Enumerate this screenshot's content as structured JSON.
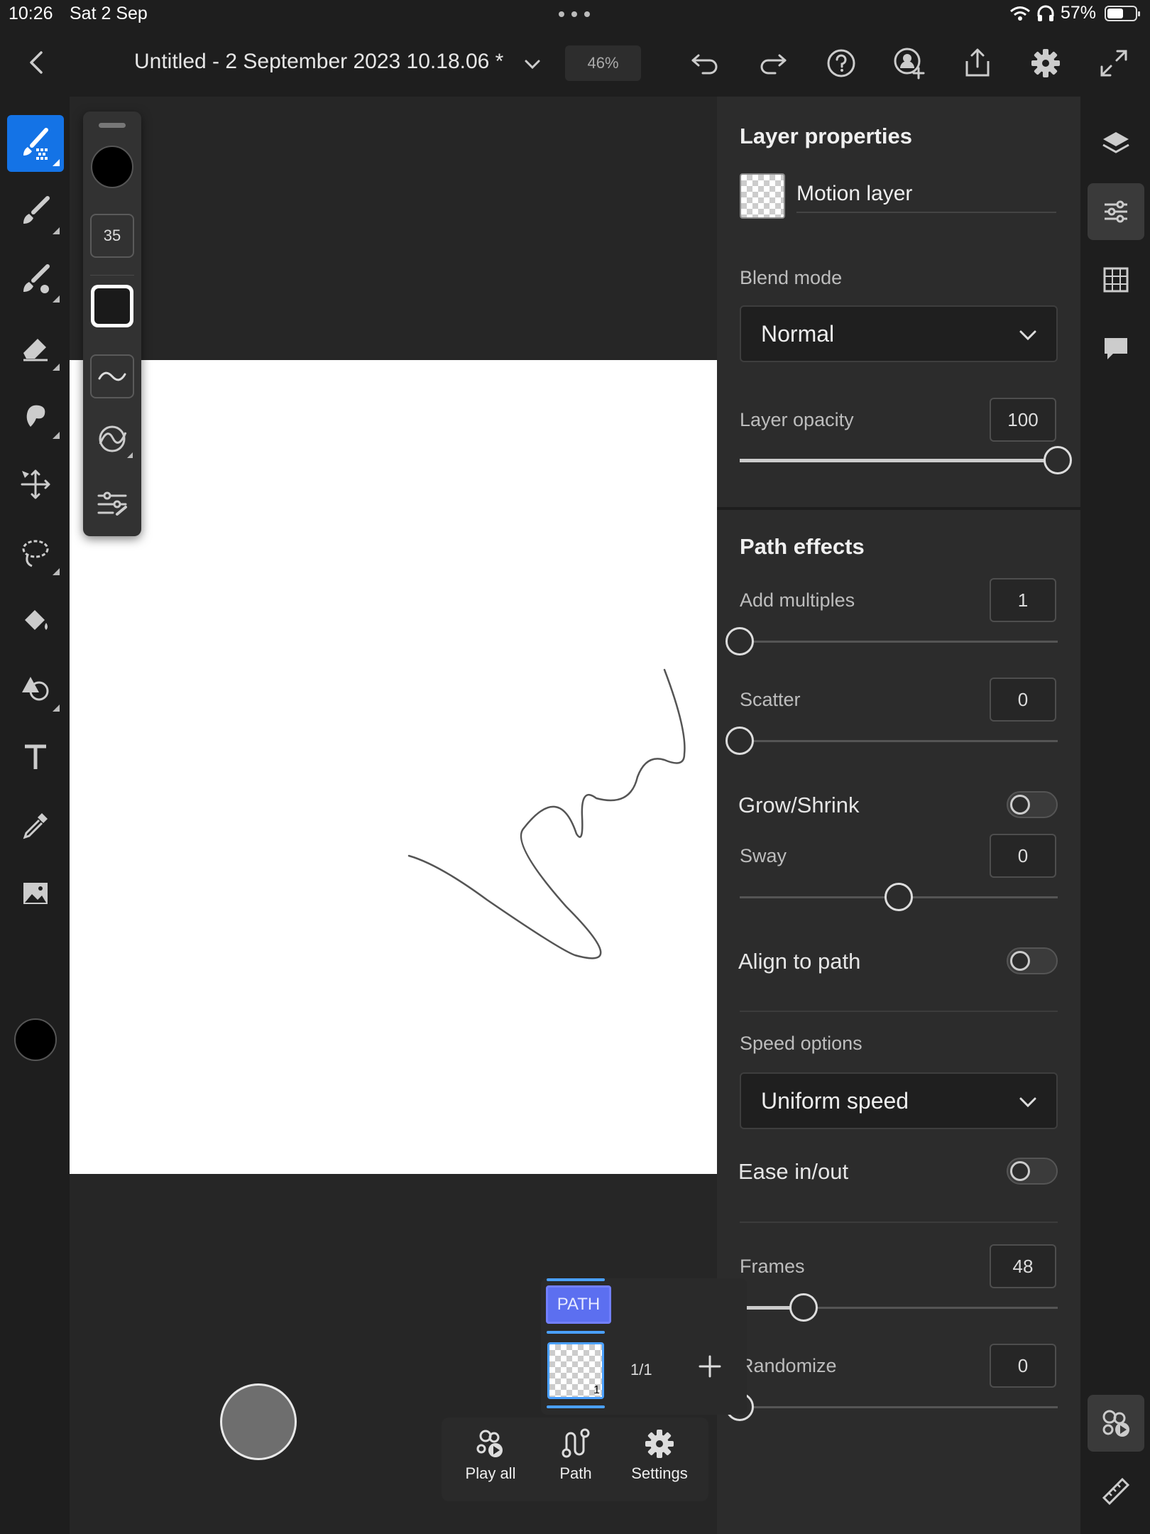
{
  "status_bar": {
    "time": "10:26",
    "date": "Sat 2 Sep",
    "battery_text": "57%",
    "battery_level": 0.57
  },
  "top_bar": {
    "document_title": "Untitled - 2 September 2023 10.18.06 *",
    "zoom": "46%",
    "icons": [
      "back-icon",
      "chevron-down-icon",
      "undo-icon",
      "redo-icon",
      "help-icon",
      "invite-icon",
      "share-icon",
      "settings-icon",
      "fullscreen-icon"
    ]
  },
  "tools": [
    "brush-tool-icon",
    "pixel-brush-icon",
    "vector-brush-icon",
    "eraser-icon",
    "smudge-icon",
    "move-icon",
    "lasso-icon",
    "fill-icon",
    "shapes-icon",
    "text-icon",
    "eyedropper-icon",
    "image-icon"
  ],
  "brush_panel": {
    "size": "35",
    "color": "#000000"
  },
  "layer_properties": {
    "title": "Layer properties",
    "layer_name": "Motion layer",
    "blend_mode_label": "Blend mode",
    "blend_mode_value": "Normal",
    "opacity_label": "Layer opacity",
    "opacity_value": "100",
    "opacity_level": 1.0
  },
  "path_effects": {
    "title": "Path effects",
    "add_multiples_label": "Add multiples",
    "add_multiples_value": "1",
    "add_multiples_level": 0.0,
    "scatter_label": "Scatter",
    "scatter_value": "0",
    "scatter_level": 0.0,
    "grow_shrink_label": "Grow/Shrink",
    "grow_shrink_on": false,
    "sway_label": "Sway",
    "sway_value": "0",
    "sway_level": 0.5,
    "align_label": "Align to path",
    "align_on": false,
    "speed_label": "Speed options",
    "speed_value": "Uniform speed",
    "ease_label": "Ease in/out",
    "ease_on": false,
    "frames_label": "Frames",
    "frames_value": "48",
    "frames_level": 0.2,
    "randomize_label": "Randomize",
    "randomize_value": "0",
    "randomize_level": 0.0
  },
  "timeline": {
    "path_chip": "PATH",
    "frame_number": "1",
    "frame_count": "1/1"
  },
  "bottom_bar": {
    "play_all": "Play all",
    "path": "Path",
    "settings": "Settings"
  },
  "accent_color": "#1473e6"
}
